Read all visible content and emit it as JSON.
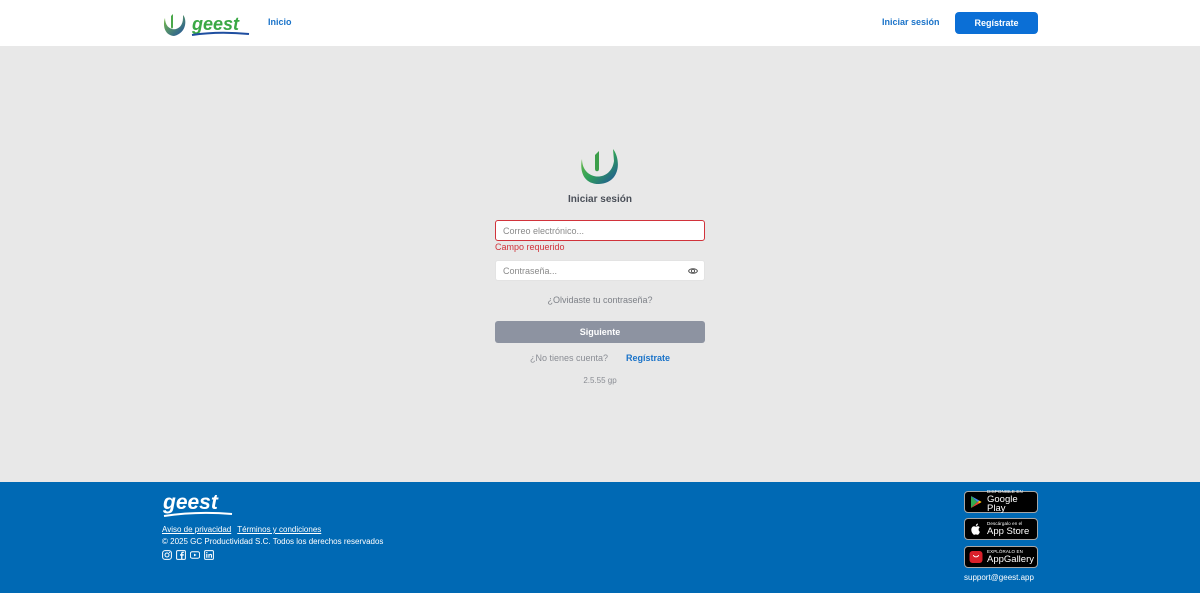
{
  "header": {
    "logo_text": "geest",
    "nav_home": "Inicio",
    "nav_login": "Iniciar sesión",
    "nav_register": "Regístrate"
  },
  "login": {
    "title": "Iniciar sesión",
    "email_placeholder": "Correo electrónico...",
    "email_value": "",
    "email_error": "Campo requerido",
    "password_placeholder": "Contraseña...",
    "password_value": "",
    "forgot_password": "¿Olvidaste tu contraseña?",
    "next_button": "Siguiente",
    "no_account": "¿No tienes cuenta?",
    "register_link": "Regístrate",
    "version": "2.5.55 gp"
  },
  "footer": {
    "logo_text": "geest",
    "privacy": "Aviso de privacidad",
    "terms": "Términos y condiciones",
    "copyright": "© 2025 GC Productividad S.C. Todos los derechos reservados",
    "socials": [
      "instagram-icon",
      "facebook-icon",
      "youtube-icon",
      "linkedin-icon"
    ],
    "stores": {
      "google_play_small": "DISPONIBLE EN",
      "google_play_big": "Google Play",
      "app_store_small": "Descárgalo en el",
      "app_store_big": "App Store",
      "app_gallery_small": "EXPLÓRALO EN",
      "app_gallery_big": "AppGallery"
    },
    "support_email": "support@geest.app"
  },
  "colors": {
    "brand_blue": "#0069b4",
    "link_blue": "#1a73c9",
    "button_blue": "#0b6fd6",
    "error_red": "#d1333b",
    "disabled_button": "#8d93a1",
    "page_bg": "#e8e8e8"
  }
}
